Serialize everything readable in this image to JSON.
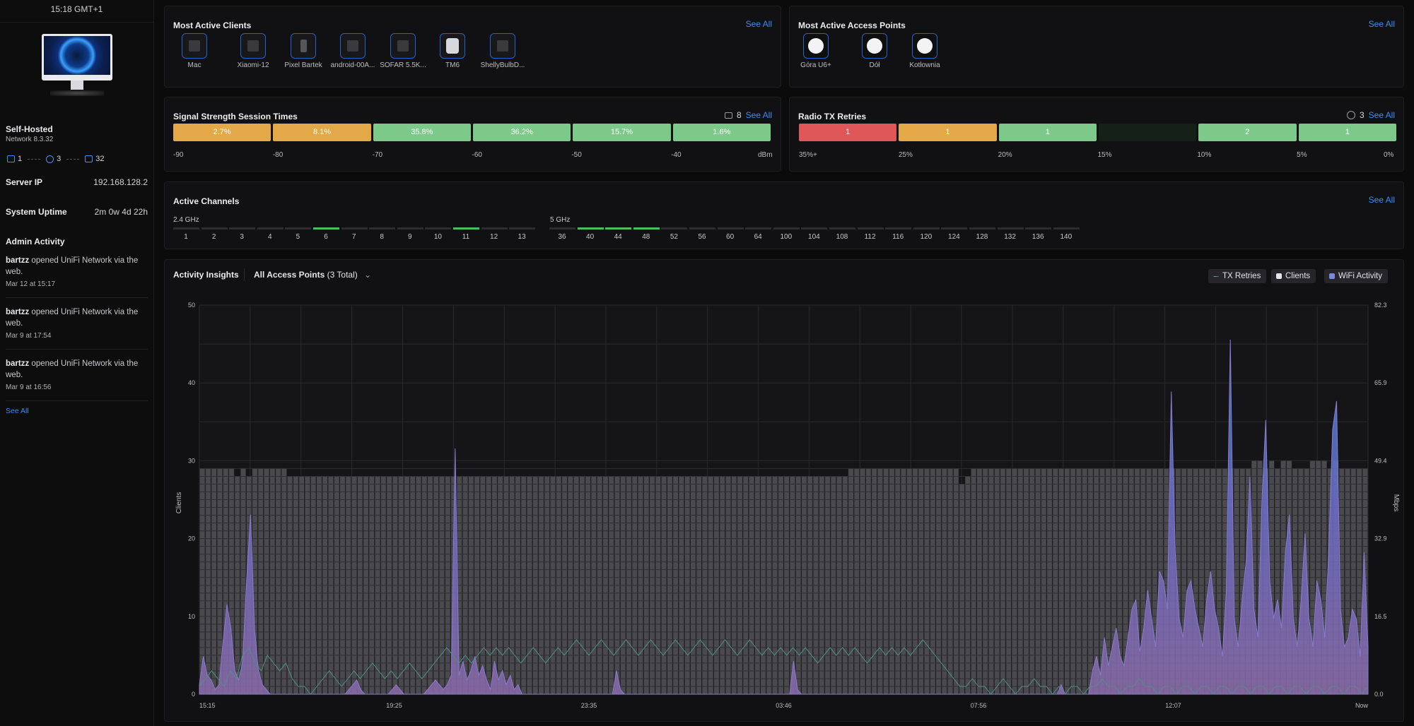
{
  "sidebar": {
    "clock": "15:18 GMT+1",
    "site_name": "Self-Hosted",
    "network_version": "Network 8.3.32",
    "counts": {
      "gateways": "1",
      "access_points": "3",
      "clients": "32"
    },
    "server_ip_label": "Server IP",
    "server_ip": "192.168.128.2",
    "uptime_label": "System Uptime",
    "uptime": "2m 0w 4d 22h",
    "admin_activity_title": "Admin Activity",
    "activities": [
      {
        "user": "bartzz",
        "text": " opened UniFi Network via the web.",
        "time": "Mar 12 at 15:17"
      },
      {
        "user": "bartzz",
        "text": " opened UniFi Network via the web.",
        "time": "Mar 9 at 17:54"
      },
      {
        "user": "bartzz",
        "text": " opened UniFi Network via the web.",
        "time": "Mar 9 at 16:56"
      }
    ],
    "see_all": "See All"
  },
  "clients_panel": {
    "title": "Most Active Clients",
    "see_all": "See All",
    "clients": [
      "Mac",
      "Xiaomi-12",
      "Pixel Bartek",
      "android-00A...",
      "SOFAR 5.5K...",
      "TM6",
      "ShellyBulbD..."
    ]
  },
  "ap_panel": {
    "title": "Most Active Access Points",
    "see_all": "See All",
    "aps": [
      "Góra U6+",
      "Dół",
      "Kotłownia"
    ]
  },
  "signal_panel": {
    "title": "Signal Strength Session Times",
    "count": "8",
    "see_all": "See All",
    "segments": [
      {
        "label": "2.7%",
        "color": "#e3a848"
      },
      {
        "label": "8.1%",
        "color": "#e3a848"
      },
      {
        "label": "35.8%",
        "color": "#7dc98a"
      },
      {
        "label": "36.2%",
        "color": "#7dc98a"
      },
      {
        "label": "15.7%",
        "color": "#7dc98a"
      },
      {
        "label": "1.6%",
        "color": "#7dc98a"
      }
    ],
    "ticks": [
      "-90",
      "-80",
      "-70",
      "-60",
      "-50",
      "-40",
      "dBm"
    ]
  },
  "retries_panel": {
    "title": "Radio TX Retries",
    "count": "3",
    "see_all": "See All",
    "segments": [
      {
        "label": "1",
        "color": "#e0575a"
      },
      {
        "label": "1",
        "color": "#e3a848"
      },
      {
        "label": "1",
        "color": "#7dc98a"
      },
      {
        "label": "",
        "color": "#152019"
      },
      {
        "label": "2",
        "color": "#7dc98a"
      },
      {
        "label": "1",
        "color": "#7dc98a"
      }
    ],
    "ticks": [
      "35%+",
      "25%",
      "20%",
      "15%",
      "10%",
      "5%",
      "0%"
    ]
  },
  "channels_panel": {
    "title": "Active Channels",
    "see_all": "See All",
    "band24_label": "2.4 GHz",
    "band5_label": "5 GHz",
    "channels24": [
      "1",
      "2",
      "3",
      "4",
      "5",
      "6",
      "7",
      "8",
      "9",
      "10",
      "11",
      "12",
      "13"
    ],
    "active24": [
      "6",
      "11"
    ],
    "channels5": [
      "36",
      "40",
      "44",
      "48",
      "52",
      "56",
      "60",
      "64",
      "100",
      "104",
      "108",
      "112",
      "116",
      "120",
      "124",
      "128",
      "132",
      "136",
      "140"
    ],
    "active5": [
      "40",
      "44",
      "48"
    ],
    "active_color": "#4bbd5c"
  },
  "insights": {
    "title": "Activity Insights",
    "filter_label": "All Access Points",
    "filter_count": "(3 Total)",
    "legend": [
      {
        "label": "TX Retries",
        "color": "#5aa8a0"
      },
      {
        "label": "Clients",
        "color": "#e6e6ea"
      },
      {
        "label": "WiFi Activity",
        "color": "#7a8bdc"
      }
    ]
  },
  "chart_data": {
    "type": "area",
    "title": "",
    "ylabel_left": "Clients",
    "ylabel_right": "Mbps",
    "y_left_ticks": [
      "0",
      "10",
      "20",
      "30",
      "40",
      "50"
    ],
    "y_left_range": [
      0,
      50
    ],
    "y_right_ticks": [
      "0.0",
      "16.5",
      "32.9",
      "49.4",
      "65.9",
      "82.3"
    ],
    "y_right_range": [
      0,
      82.3
    ],
    "x_ticks": [
      "15:15",
      "19:25",
      "23:35",
      "03:46",
      "07:56",
      "12:07",
      "Now"
    ],
    "grid": true,
    "series": [
      {
        "name": "Clients",
        "values": [
          29,
          29,
          29,
          29,
          29,
          29,
          28,
          29,
          28,
          29,
          29,
          29,
          29,
          29,
          29,
          28,
          28,
          28,
          28,
          28,
          28,
          28,
          28,
          28,
          28,
          28,
          28,
          28,
          28,
          28,
          28,
          28,
          28,
          28,
          28,
          28,
          28,
          28,
          28,
          28,
          28,
          28,
          28,
          28,
          28,
          28,
          28,
          28,
          28,
          28,
          28,
          28,
          28,
          28,
          28,
          28,
          28,
          28,
          28,
          28,
          28,
          28,
          28,
          28,
          28,
          28,
          28,
          28,
          28,
          28,
          28,
          28,
          28,
          28,
          28,
          28,
          28,
          28,
          28,
          28,
          28,
          28,
          28,
          28,
          28,
          28,
          28,
          28,
          28,
          28,
          28,
          28,
          28,
          28,
          28,
          28,
          28,
          28,
          28,
          28,
          28,
          28,
          28,
          28,
          28,
          28,
          28,
          28,
          28,
          28,
          28,
          29,
          29,
          29,
          29,
          29,
          29,
          29,
          29,
          29,
          29,
          29,
          29,
          29,
          29,
          29,
          29,
          29,
          29,
          29,
          27,
          28,
          29,
          29,
          29,
          29,
          29,
          29,
          29,
          29,
          29,
          29,
          29,
          29,
          29,
          29,
          29,
          29,
          29,
          29,
          29,
          29,
          29,
          29,
          29,
          29,
          29,
          29,
          29,
          29,
          29,
          29,
          29,
          29,
          29,
          29,
          29,
          29,
          29,
          29,
          29,
          29,
          29,
          29,
          29,
          29,
          29,
          29,
          29,
          29,
          30,
          30,
          29,
          30,
          29,
          30,
          30,
          29,
          29,
          29,
          30,
          30,
          30,
          29,
          30,
          29,
          29,
          29,
          29,
          29
        ]
      },
      {
        "name": "WiFi Activity",
        "values": [
          2,
          8,
          4,
          3,
          1,
          2,
          11,
          19,
          14,
          5,
          3,
          7,
          24,
          38,
          14,
          5,
          2,
          1,
          0,
          0,
          0,
          0,
          0,
          0,
          0,
          0,
          0,
          0,
          0,
          0,
          0,
          0,
          0,
          0,
          0,
          0,
          0,
          0,
          1,
          2,
          3,
          1,
          0,
          0,
          0,
          0,
          0,
          0,
          0,
          1,
          2,
          1,
          0,
          0,
          0,
          0,
          0,
          0,
          1,
          2,
          3,
          2,
          1,
          2,
          4,
          52,
          4,
          7,
          3,
          5,
          8,
          4,
          6,
          3,
          1,
          7,
          3,
          5,
          2,
          4,
          1,
          2,
          0,
          0,
          0,
          0,
          0,
          0,
          0,
          0,
          0,
          0,
          0,
          0,
          0,
          0,
          0,
          0,
          0,
          0,
          0,
          0,
          0,
          0,
          0,
          0,
          5,
          1,
          0,
          0,
          0,
          0,
          0,
          0,
          0,
          0,
          0,
          0,
          0,
          0,
          0,
          0,
          0,
          0,
          0,
          0,
          0,
          0,
          0,
          0,
          0,
          0,
          0,
          0,
          0,
          0,
          0,
          0,
          0,
          0,
          0,
          0,
          0,
          0,
          0,
          0,
          0,
          0,
          0,
          0,
          0,
          7,
          1,
          0,
          0,
          0,
          0,
          0,
          0,
          0,
          0,
          0,
          0,
          0,
          0,
          0,
          0,
          0,
          0,
          0,
          0,
          0,
          0,
          0,
          0,
          0,
          0,
          0,
          0,
          0,
          0,
          0,
          0,
          0,
          0,
          0,
          0,
          0,
          0,
          0,
          0,
          0,
          0,
          0,
          0,
          0,
          0,
          0,
          0,
          0,
          0,
          0,
          0,
          0,
          0,
          0,
          0,
          0,
          0,
          0,
          0,
          0,
          0,
          0,
          0,
          0,
          0,
          0,
          0,
          2,
          0,
          0,
          0,
          0,
          0,
          0,
          0,
          5,
          8,
          4,
          12,
          6,
          10,
          14,
          8,
          6,
          12,
          18,
          20,
          9,
          14,
          22,
          16,
          10,
          26,
          24,
          18,
          64,
          30,
          16,
          12,
          22,
          24,
          18,
          14,
          10,
          20,
          26,
          18,
          14,
          8,
          22,
          75,
          16,
          10,
          20,
          28,
          46,
          18,
          12,
          40,
          58,
          24,
          16,
          20,
          14,
          30,
          38,
          16,
          10,
          20,
          34,
          16,
          10,
          24,
          20,
          12,
          30,
          56,
          62,
          18,
          10,
          12,
          18,
          16,
          8,
          30,
          10
        ]
      },
      {
        "name": "TX Retries",
        "values": [
          1,
          2,
          3,
          2,
          1,
          3,
          2,
          5,
          6,
          4,
          3,
          5,
          4,
          3,
          4,
          2,
          1,
          1,
          0,
          1,
          2,
          3,
          2,
          1,
          2,
          3,
          2,
          3,
          4,
          3,
          2,
          3,
          2,
          3,
          4,
          3,
          2,
          3,
          4,
          5,
          6,
          5,
          4,
          5,
          4,
          5,
          6,
          5,
          6,
          5,
          6,
          5,
          4,
          5,
          6,
          5,
          4,
          5,
          6,
          5,
          6,
          7,
          6,
          5,
          6,
          7,
          6,
          5,
          6,
          7,
          6,
          5,
          6,
          7,
          6,
          5,
          6,
          7,
          6,
          5,
          6,
          7,
          6,
          5,
          6,
          7,
          6,
          5,
          6,
          7,
          6,
          5,
          6,
          5,
          6,
          5,
          6,
          5,
          6,
          5,
          4,
          5,
          6,
          5,
          6,
          5,
          6,
          5,
          4,
          5,
          6,
          5,
          6,
          5,
          6,
          5,
          6,
          7,
          6,
          5,
          4,
          3,
          2,
          1,
          1,
          2,
          1,
          1,
          0,
          1,
          2,
          1,
          0,
          1,
          1,
          2,
          1,
          1,
          0,
          1,
          0,
          1,
          1,
          0,
          1,
          1,
          2,
          1,
          1,
          0,
          1,
          1,
          2,
          1,
          1,
          0,
          1,
          1,
          0,
          1,
          1,
          0,
          1,
          1,
          0,
          1,
          1,
          0,
          1,
          1,
          0,
          1,
          1,
          0,
          1,
          1,
          0,
          1,
          1,
          0,
          1,
          1,
          0,
          1,
          1,
          0,
          1,
          1,
          0,
          1
        ]
      }
    ]
  }
}
